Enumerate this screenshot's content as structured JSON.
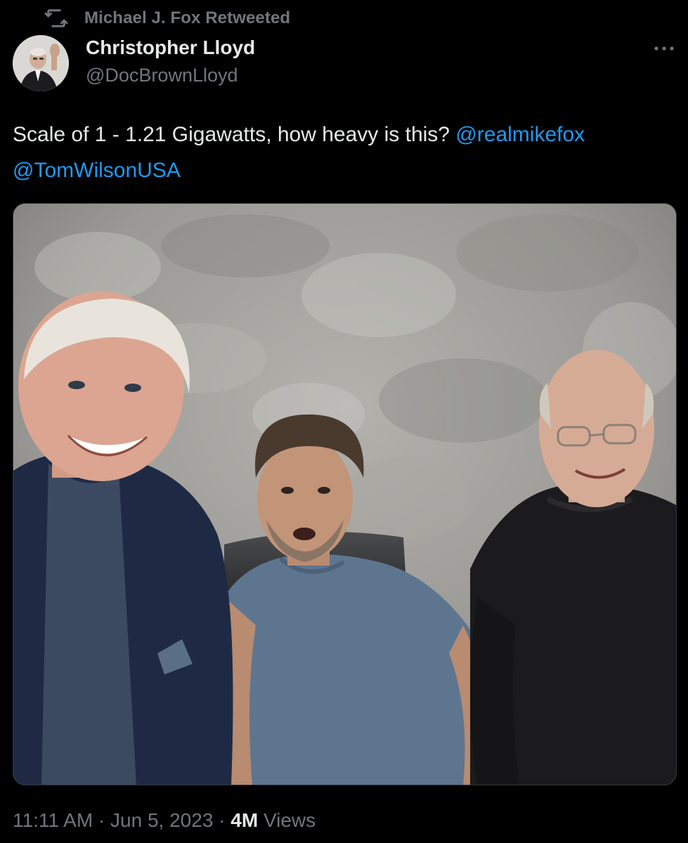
{
  "retweet": {
    "icon": "retweet-icon",
    "text": "Michael J. Fox Retweeted"
  },
  "author": {
    "name": "Christopher Lloyd",
    "handle": "@DocBrownLloyd",
    "avatar_icon": "avatar"
  },
  "more_icon": "more-horizontal-icon",
  "tweet": {
    "text_part1": "Scale of 1 - 1.21 Gigawatts, how heavy is this? ",
    "mention1": "@realmikefox",
    "mention2": "@TomWilsonUSA"
  },
  "photo": {
    "description_icon": "photo-three-men"
  },
  "meta": {
    "time": "11:11 AM",
    "separator1": " · ",
    "date": "Jun 5, 2023",
    "separator2": " · ",
    "views_count": "4M",
    "views_label": " Views"
  },
  "colors": {
    "background": "#000000",
    "primary_text": "#e7e9ea",
    "secondary_text": "#71767b",
    "link": "#1d9bf0",
    "border": "#2f3336"
  }
}
